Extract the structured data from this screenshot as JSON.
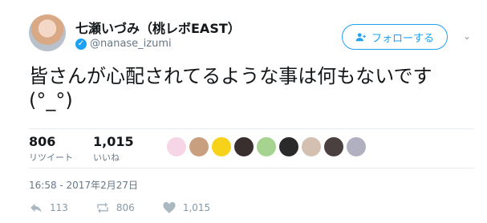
{
  "user": {
    "name": "七瀬いづみ（桃レボEAST）",
    "handle": "@nanase_izumi"
  },
  "follow_button": {
    "label": "フォローする"
  },
  "tweet": {
    "text": "皆さんが心配されてるような事は何もないです\n(°_°)",
    "timestamp": "16:58 - 2017年2月27日"
  },
  "stats": {
    "retweets": {
      "count": "806",
      "label": "リツイート"
    },
    "likes": {
      "count": "1,015",
      "label": "いいね"
    }
  },
  "likers_colors": [
    "#f6d6e6",
    "#c8a080",
    "#f7d21a",
    "#3a2f2f",
    "#a6d38f",
    "#2a2a2a",
    "#d4c0b0",
    "#4a4040",
    "#b0b0c0"
  ],
  "actions": {
    "reply_count": "113",
    "retweet_count": "806",
    "like_count": "1,015"
  },
  "colors": {
    "accent": "#1da1f2",
    "muted": "#657786"
  }
}
